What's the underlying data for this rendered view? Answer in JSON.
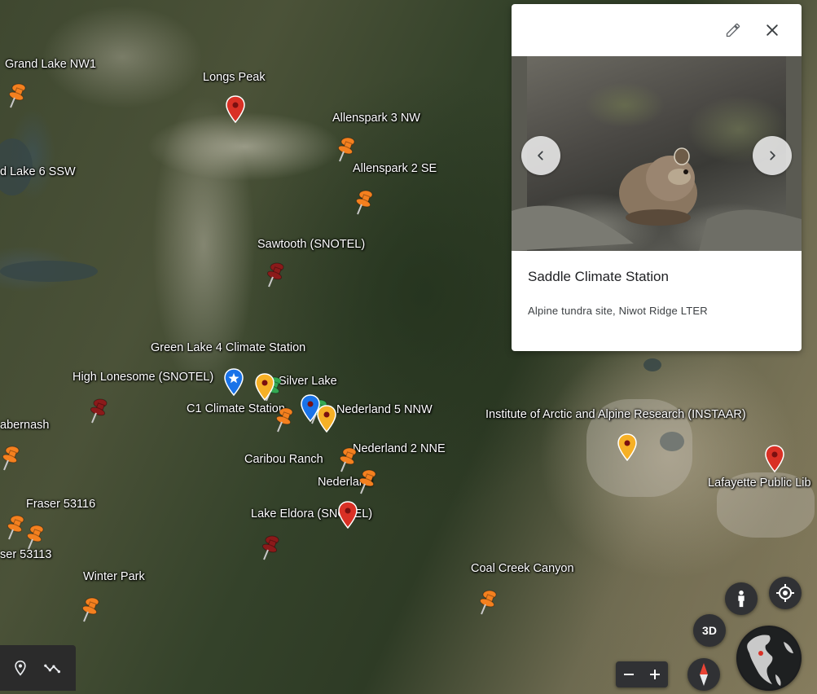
{
  "map": {
    "labels": [
      {
        "id": "grand-lake-nw1",
        "text": "Grand Lake NW1"
      },
      {
        "id": "longs-peak",
        "text": "Longs Peak"
      },
      {
        "id": "allenspark-3nw",
        "text": "Allenspark 3 NW"
      },
      {
        "id": "lake-6ssw",
        "text": "d Lake 6 SSW"
      },
      {
        "id": "allenspark-2se",
        "text": "Allenspark 2 SE"
      },
      {
        "id": "sawtooth",
        "text": "Sawtooth (SNOTEL)"
      },
      {
        "id": "green-lake-4",
        "text": "Green Lake 4 Climate Station"
      },
      {
        "id": "high-lonesome",
        "text": "High Lonesome (SNOTEL)"
      },
      {
        "id": "silver-lake",
        "text": "Silver Lake"
      },
      {
        "id": "c1-climate",
        "text": "C1 Climate Station"
      },
      {
        "id": "nederland-5nnw",
        "text": "Nederland 5 NNW"
      },
      {
        "id": "instaar",
        "text": "Institute of Arctic and Alpine Research (INSTAAR)"
      },
      {
        "id": "tabernash",
        "text": "abernash"
      },
      {
        "id": "caribou-ranch",
        "text": "Caribou Ranch"
      },
      {
        "id": "nederland-2nne",
        "text": "Nederland 2 NNE"
      },
      {
        "id": "nederland",
        "text": "Nederland"
      },
      {
        "id": "lafayette",
        "text": "Lafayette Public Lib"
      },
      {
        "id": "fraser-53116",
        "text": "Fraser 53116"
      },
      {
        "id": "lake-eldora",
        "text": "Lake Eldora (SNOTEL)"
      },
      {
        "id": "fraser-53113",
        "text": "ser 53113"
      },
      {
        "id": "winter-park",
        "text": "Winter Park"
      },
      {
        "id": "coal-creek",
        "text": "Coal Creek Canyon"
      }
    ]
  },
  "card": {
    "title": "Saddle Climate Station",
    "description": "Alpine tundra site, Niwot Ridge LTER",
    "icons": {
      "edit": "pencil-icon",
      "close": "close-icon",
      "prev": "chevron-left-icon",
      "next": "chevron-right-icon"
    }
  },
  "controls": {
    "btn_3d": "3D",
    "zoom_out": "−",
    "zoom_in": "+"
  },
  "colors": {
    "pin_orange": "#f4801f",
    "pin_red": "#d93025",
    "pin_darkred": "#8b1a1a",
    "pin_blue": "#1a73e8",
    "pin_yellow": "#f6b026",
    "pin_green": "#34a853"
  }
}
